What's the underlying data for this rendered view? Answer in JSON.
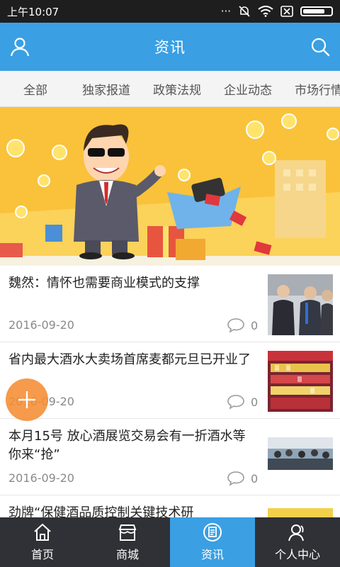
{
  "status_bar": {
    "time": "上午10:07"
  },
  "header": {
    "title": "资讯"
  },
  "tabs": [
    "全部",
    "独家报道",
    "政策法规",
    "企业动态",
    "市场行情"
  ],
  "news": [
    {
      "title": "魏然：情怀也需要商业模式的支撑",
      "date": "2016-09-20",
      "comments": "0"
    },
    {
      "title": "省内最大酒水大卖场首席麦都元旦已开业了",
      "date": "2016-09-20",
      "comments": "0"
    },
    {
      "title": "本月15号 放心酒展览交易会有一折酒水等你来“抢”",
      "date": "2016-09-20",
      "comments": "0"
    },
    {
      "title": "劲牌“保健酒品质控制关键技术研",
      "date": "",
      "comments": ""
    }
  ],
  "bottom_nav": [
    {
      "label": "首页",
      "icon": "home-icon"
    },
    {
      "label": "商城",
      "icon": "store-icon"
    },
    {
      "label": "资讯",
      "icon": "news-icon",
      "active": true
    },
    {
      "label": "个人中心",
      "icon": "user-icon"
    }
  ],
  "colors": {
    "primary": "#3a9fe3",
    "banner": "#f9c23a",
    "fab": "#f58c32",
    "nav_bg": "#2f3136"
  }
}
